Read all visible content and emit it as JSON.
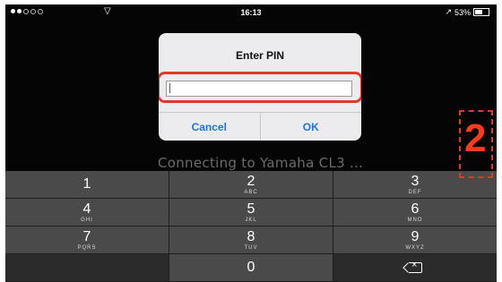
{
  "status_bar": {
    "time": "16:13",
    "battery": "53%",
    "signal_icon": "signal-dots-icon",
    "wifi_icon": "wifi-icon",
    "location_icon": "location-arrow-icon"
  },
  "background_text": "Connecting to Yamaha CL3 ...",
  "dialog": {
    "title": "Enter PIN",
    "input_value": "",
    "cancel_label": "Cancel",
    "ok_label": "OK"
  },
  "annotation": {
    "number": "2",
    "color": "#e0392a"
  },
  "keypad": {
    "keys": [
      {
        "digit": "1",
        "letters": ""
      },
      {
        "digit": "2",
        "letters": "ABC"
      },
      {
        "digit": "3",
        "letters": "DEF"
      },
      {
        "digit": "4",
        "letters": "GHI"
      },
      {
        "digit": "5",
        "letters": "JKL"
      },
      {
        "digit": "6",
        "letters": "MNO"
      },
      {
        "digit": "7",
        "letters": "PQRS"
      },
      {
        "digit": "8",
        "letters": "TUV"
      },
      {
        "digit": "9",
        "letters": "WXYZ"
      },
      {
        "digit": "0",
        "letters": ""
      }
    ],
    "backspace_icon": "backspace-icon"
  }
}
